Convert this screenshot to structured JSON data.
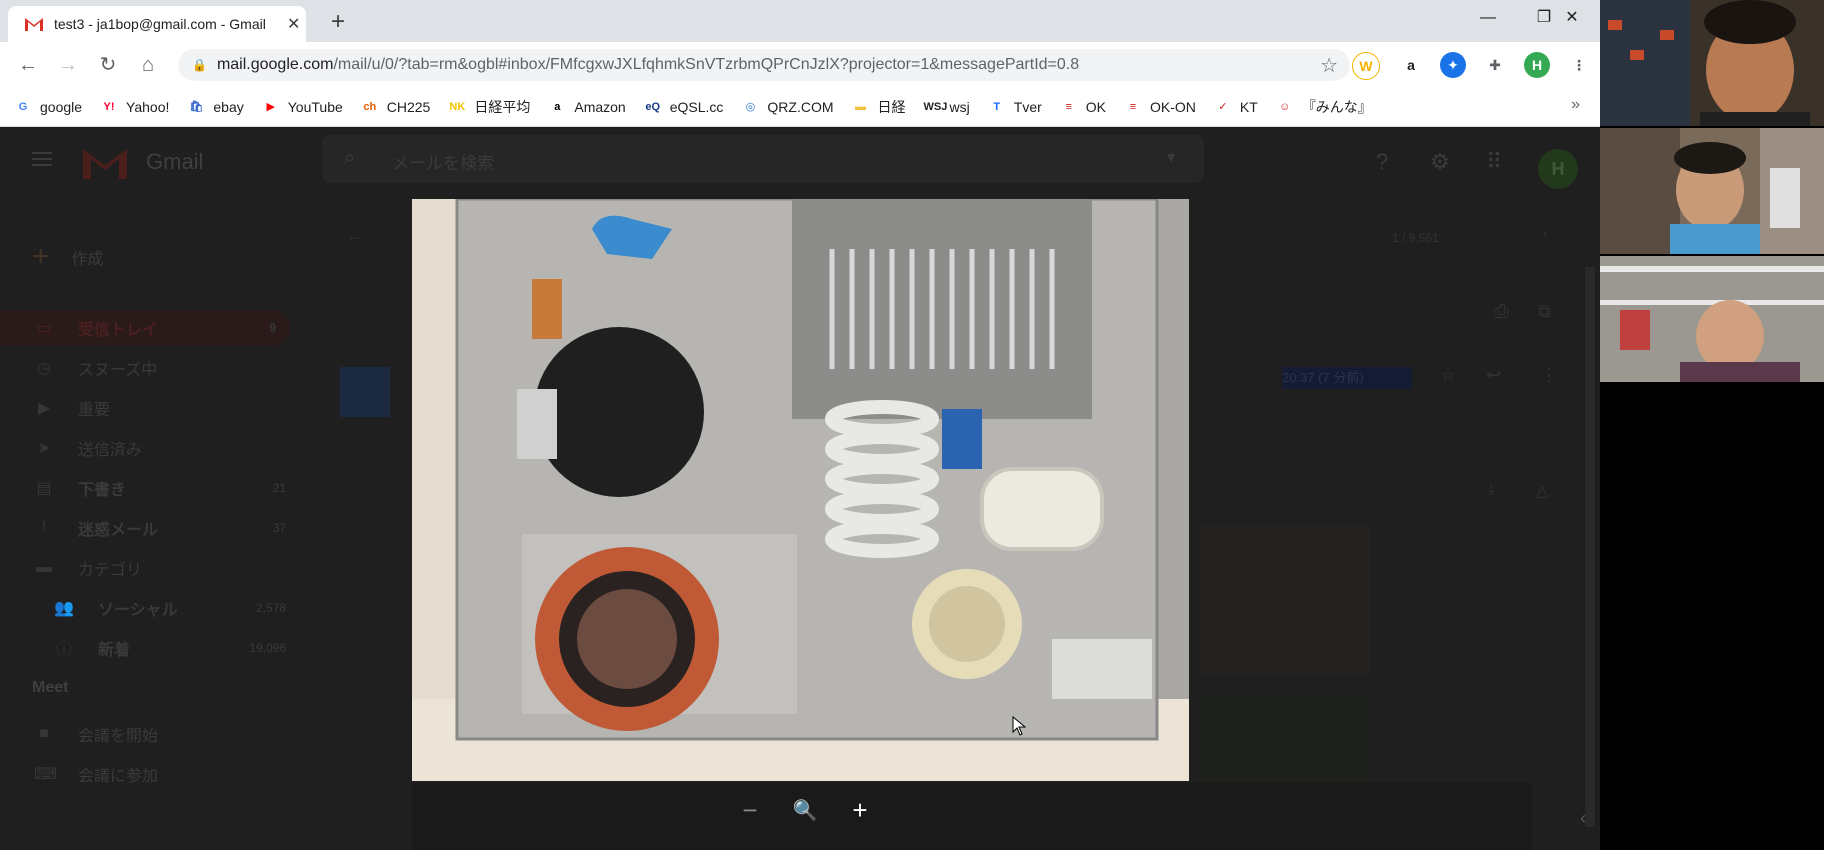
{
  "tab": {
    "title": "test3 - ja1bop@gmail.com - Gmail"
  },
  "window": {
    "minimize": "—",
    "restore": "❐",
    "close": "✕"
  },
  "nav": {
    "back": "←",
    "forward": "→",
    "reload": "↻",
    "home": "⌂"
  },
  "address": {
    "host": "mail.google.com",
    "path": "/mail/u/0/?tab=rm&ogbl#inbox/FMfcgxwJXLfqhmkSnVTzrbmQPrCnJzlX?projector=1&messagePartId=0.8"
  },
  "extensions": [
    {
      "label": "W",
      "icon": "w-extension-icon"
    },
    {
      "label": "a",
      "icon": "amazon-extension-icon"
    },
    {
      "label": "✦",
      "icon": "globe-extension-icon"
    },
    {
      "label": "✚",
      "icon": "puzzle-icon"
    },
    {
      "label": "H",
      "icon": "profile-avatar"
    },
    {
      "label": "⋮",
      "icon": "kebab-menu-icon"
    }
  ],
  "bookmarks": [
    {
      "label": "google",
      "icon": "google-icon",
      "color": "#4285f4",
      "glyph": "G"
    },
    {
      "label": "Yahoo!",
      "icon": "yahoo-icon",
      "color": "#ff0033",
      "glyph": "Y!"
    },
    {
      "label": "ebay",
      "icon": "ebay-icon",
      "color": "#3366cc",
      "glyph": "🛍"
    },
    {
      "label": "YouTube",
      "icon": "youtube-icon",
      "color": "#ff0000",
      "glyph": "▶"
    },
    {
      "label": "CH225",
      "icon": "ch225-icon",
      "color": "#e65c00",
      "glyph": "ch"
    },
    {
      "label": "日経平均",
      "icon": "nk-icon",
      "color": "#f5c400",
      "glyph": "NK"
    },
    {
      "label": "Amazon",
      "icon": "amazon-icon",
      "color": "#000000",
      "glyph": "a"
    },
    {
      "label": "eQSL.cc",
      "icon": "eqsl-icon",
      "color": "#1a3a8a",
      "glyph": "eQ"
    },
    {
      "label": "QRZ.COM",
      "icon": "qrz-icon",
      "color": "#2a7ad5",
      "glyph": "◎"
    },
    {
      "label": "日経",
      "icon": "folder-icon",
      "color": "#f0c040",
      "glyph": "▬"
    },
    {
      "label": "wsj",
      "icon": "wsj-icon",
      "color": "#222222",
      "glyph": "WSJ"
    },
    {
      "label": "Tver",
      "icon": "tver-icon",
      "color": "#1a66ff",
      "glyph": "T"
    },
    {
      "label": "OK",
      "icon": "ok-icon",
      "color": "#cc2222",
      "glyph": "≡"
    },
    {
      "label": "OK-ON",
      "icon": "okon-icon",
      "color": "#cc2222",
      "glyph": "≡"
    },
    {
      "label": "KT",
      "icon": "kt-icon",
      "color": "#cc2222",
      "glyph": "✓"
    },
    {
      "label": "『みんな』",
      "icon": "minna-icon",
      "color": "#cc2222",
      "glyph": "☺"
    }
  ],
  "bookmarks_more": "»",
  "gmail": {
    "logo_text": "Gmail",
    "search_placeholder": "メールを検索",
    "compose": "作成",
    "nav": [
      {
        "label": "受信トレイ",
        "count": "9"
      },
      {
        "label": "スヌーズ中",
        "count": ""
      },
      {
        "label": "重要",
        "count": ""
      },
      {
        "label": "送信済み",
        "count": ""
      },
      {
        "label": "下書き",
        "count": "21"
      },
      {
        "label": "迷惑メール",
        "count": "37"
      },
      {
        "label": "カテゴリ",
        "count": ""
      },
      {
        "label": "ソーシャル",
        "count": "2,578"
      },
      {
        "label": "新着",
        "count": "19,096"
      }
    ],
    "meet_title": "Meet",
    "meet_items": [
      {
        "label": "会議を開始"
      },
      {
        "label": "会議に参加"
      }
    ],
    "pager": "1 / 9,561",
    "timestamp": "20:37 (7 分前)"
  },
  "viewer": {
    "zoom_out": "−",
    "zoom_reset": "🔍",
    "zoom_in": "+"
  }
}
